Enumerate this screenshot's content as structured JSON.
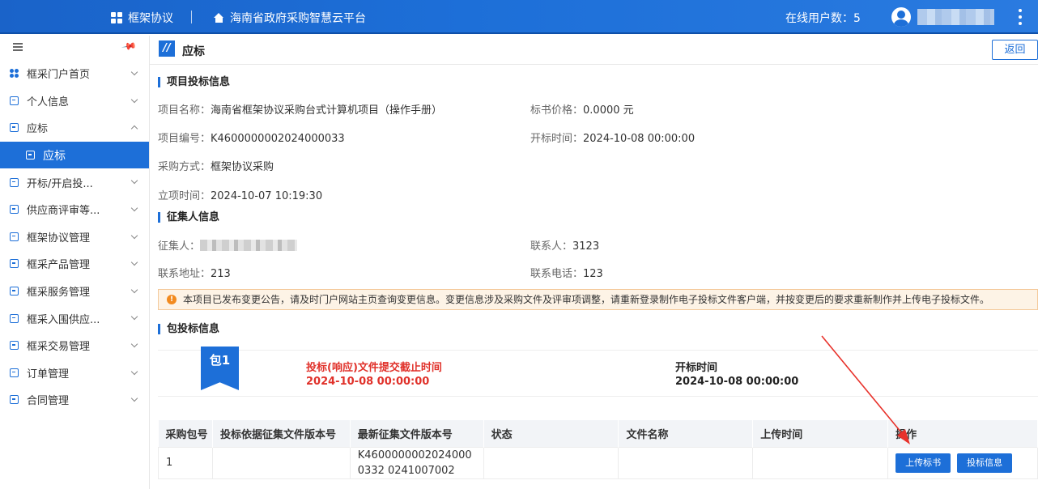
{
  "topbar": {
    "app_name": "框架协议",
    "platform": "海南省政府采购智慧云平台",
    "online_users": "在线用户数：5"
  },
  "sidebar": {
    "items": [
      {
        "label": "框采门户首页",
        "icon": "apps-icon"
      },
      {
        "label": "个人信息",
        "icon": "profile-icon"
      },
      {
        "label": "应标",
        "icon": "bid-icon",
        "expanded": true
      },
      {
        "label": "应标",
        "icon": "bid-icon",
        "active": true
      },
      {
        "label": "开标/开启投...",
        "icon": "open-bid-icon"
      },
      {
        "label": "供应商评审等...",
        "icon": "review-icon"
      },
      {
        "label": "框架协议管理",
        "icon": "agreement-icon"
      },
      {
        "label": "框采产品管理",
        "icon": "product-icon"
      },
      {
        "label": "框采服务管理",
        "icon": "service-icon"
      },
      {
        "label": "框采入围供应...",
        "icon": "supplier-icon"
      },
      {
        "label": "框采交易管理",
        "icon": "trade-icon"
      },
      {
        "label": "订单管理",
        "icon": "order-icon"
      },
      {
        "label": "合同管理",
        "icon": "contract-icon"
      }
    ]
  },
  "page": {
    "title": "应标",
    "back_label": "返回"
  },
  "project": {
    "section_title": "项目投标信息",
    "name_label": "项目名称：",
    "name": "海南省框架协议采购台式计算机项目（操作手册）",
    "price_label": "标书价格：",
    "price": "0.0000 元",
    "code_label": "项目编号：",
    "code": "K4600000002024000033",
    "open_time_label": "开标时间：",
    "open_time": "2024-10-08 00:00:00",
    "method_label": "采购方式：",
    "method": "框架协议采购",
    "setup_time_label": "立项时间：",
    "setup_time": "2024-10-07 10:19:30"
  },
  "collector": {
    "section_title": "征集人信息",
    "collector_label": "征集人：",
    "contact_label": "联系人：",
    "contact": "3123",
    "address_label": "联系地址：",
    "address": "213",
    "phone_label": "联系电话：",
    "phone": "123"
  },
  "notice": "本项目已发布变更公告，请及时门户网站主页查询变更信息。变更信息涉及采购文件及评审项调整，请重新登录制作电子投标文件客户端，并按变更后的要求重新制作并上传电子投标文件。",
  "package": {
    "section_title": "包投标信息",
    "badge": "包1",
    "deadline_label": "投标(响应)文件提交截止时间",
    "deadline": "2024-10-08 00:00:00",
    "open_label": "开标时间",
    "open_time": "2024-10-08 00:00:00"
  },
  "table": {
    "headers": [
      "采购包号",
      "投标依据征集文件版本号",
      "最新征集文件版本号",
      "状态",
      "文件名称",
      "上传时间",
      "操作"
    ],
    "rows": [
      {
        "pkg": "1",
        "basis_version": "",
        "latest_version": "K46000000020240000332 0241007002",
        "status": "",
        "file_name": "",
        "upload_time": ""
      }
    ],
    "upload_button": "上传标书",
    "info_button": "投标信息"
  },
  "colors": {
    "primary": "#1d6fd8",
    "danger": "#e0312a",
    "notice_bg": "#fdf3e6",
    "arrow": "#e8322b"
  }
}
